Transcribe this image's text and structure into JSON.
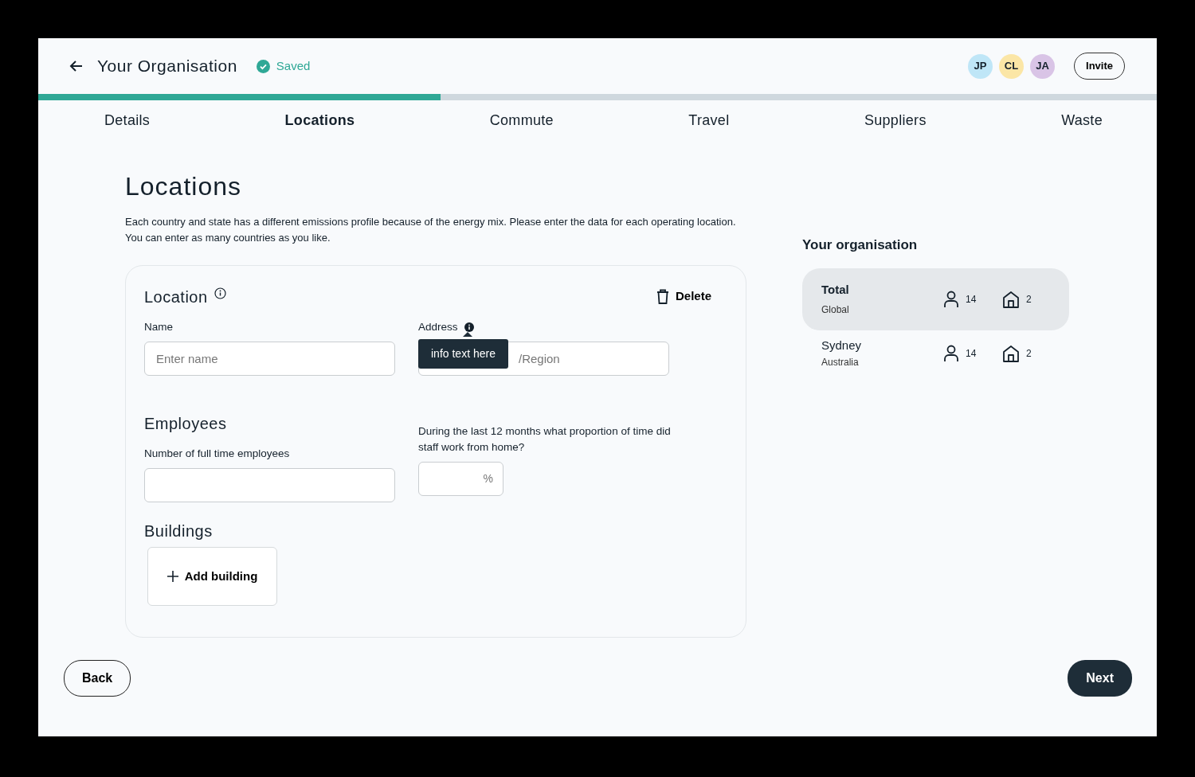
{
  "header": {
    "title": "Your Organisation",
    "status": "Saved",
    "avatars": [
      {
        "initials": "JP",
        "color": "#bfe6f7"
      },
      {
        "initials": "CL",
        "color": "#fbe6a6"
      },
      {
        "initials": "JA",
        "color": "#d9c4e6"
      }
    ],
    "invite": "Invite"
  },
  "progress": {
    "level": 0.36
  },
  "tabs": [
    {
      "label": "Details",
      "selected": false
    },
    {
      "label": "Locations",
      "selected": true
    },
    {
      "label": "Commute",
      "selected": false
    },
    {
      "label": "Travel",
      "selected": false
    },
    {
      "label": "Suppliers",
      "selected": false
    },
    {
      "label": "Waste",
      "selected": false
    }
  ],
  "page": {
    "title": "Locations",
    "description": "Each country and state has a different emissions profile because of the energy mix. Please enter the data for each operating location. You can enter as many countries as you like."
  },
  "location_card": {
    "title": "Location",
    "delete": "Delete",
    "name_label": "Name",
    "name_placeholder": "Enter name",
    "address_label": "Address",
    "address_placeholder": "/Region",
    "tooltip": "info text here",
    "employees_title": "Employees",
    "employees_label": "Number of full time employees",
    "wfh_label": "During the last 12 months what proportion of time did staff work from home?",
    "wfh_unit": "%",
    "buildings_title": "Buildings",
    "add_building": "Add building"
  },
  "summary": {
    "title": "Your organisation",
    "rows": [
      {
        "name": "Total",
        "region": "Global",
        "employees": "14",
        "buildings": "2",
        "selected": true
      },
      {
        "name": "Sydney",
        "region": "Australia",
        "employees": "14",
        "buildings": "2",
        "selected": false
      }
    ]
  },
  "footer": {
    "back": "Back",
    "next": "Next"
  }
}
